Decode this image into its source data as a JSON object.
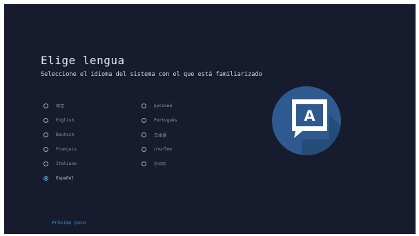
{
  "setup": {
    "title": "Elige lengua",
    "subtitle": "Seleccione el idioma del sistema con el que está familiarizado",
    "languages": [
      {
        "label": "中文",
        "selected": false
      },
      {
        "label": "English",
        "selected": false
      },
      {
        "label": "Deutsch",
        "selected": false
      },
      {
        "label": "Français",
        "selected": false
      },
      {
        "label": "Italiano",
        "selected": false
      },
      {
        "label": "Español",
        "selected": true
      },
      {
        "label": "русский",
        "selected": false
      },
      {
        "label": "Português",
        "selected": false
      },
      {
        "label": "日本語",
        "selected": false
      },
      {
        "label": "ภาษาไทย",
        "selected": false
      },
      {
        "label": "한국어",
        "selected": false
      }
    ],
    "next_label": "Próximo paso",
    "illustration": {
      "icon": "language-letter-a-icon",
      "glyph": "A",
      "circle_color": "#2e5a8f",
      "shadow_color": "#244a77"
    },
    "colors": {
      "background": "#161c2d",
      "accent": "#4aa3e0",
      "link": "#3f8fd6"
    }
  }
}
